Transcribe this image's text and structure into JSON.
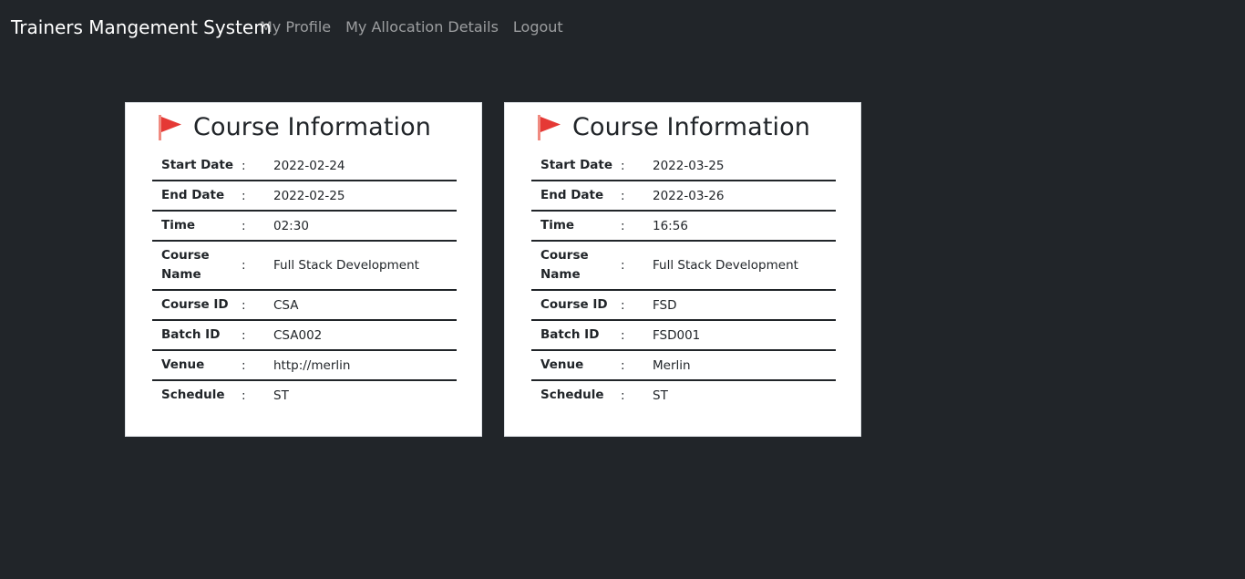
{
  "navbar": {
    "brand": "Trainers Mangement System",
    "links": [
      "My Profile",
      "My Allocation Details",
      "Logout"
    ]
  },
  "colors": {
    "background": "#212529",
    "card": "#ffffff",
    "flag": "#e53935"
  },
  "cards": [
    {
      "icon": "flag-icon",
      "title": "Course Information",
      "rows": [
        {
          "label": "Start Date",
          "sep": ":",
          "value": "2022-02-24"
        },
        {
          "label": "End Date",
          "sep": ":",
          "value": "2022-02-25"
        },
        {
          "label": "Time",
          "sep": ":",
          "value": "02:30"
        },
        {
          "label": "Course Name",
          "sep": ":",
          "value": "Full Stack Development"
        },
        {
          "label": "Course ID",
          "sep": ":",
          "value": "CSA"
        },
        {
          "label": "Batch ID",
          "sep": ":",
          "value": "CSA002"
        },
        {
          "label": "Venue",
          "sep": ":",
          "value": "http://merlin"
        },
        {
          "label": "Schedule",
          "sep": ":",
          "value": "ST"
        }
      ]
    },
    {
      "icon": "flag-icon",
      "title": "Course Information",
      "rows": [
        {
          "label": "Start Date",
          "sep": ":",
          "value": "2022-03-25"
        },
        {
          "label": "End Date",
          "sep": ":",
          "value": "2022-03-26"
        },
        {
          "label": "Time",
          "sep": ":",
          "value": "16:56"
        },
        {
          "label": "Course Name",
          "sep": ":",
          "value": "Full Stack Development"
        },
        {
          "label": "Course ID",
          "sep": ":",
          "value": "FSD"
        },
        {
          "label": "Batch ID",
          "sep": ":",
          "value": "FSD001"
        },
        {
          "label": "Venue",
          "sep": ":",
          "value": "Merlin"
        },
        {
          "label": "Schedule",
          "sep": ":",
          "value": "ST"
        }
      ]
    }
  ]
}
